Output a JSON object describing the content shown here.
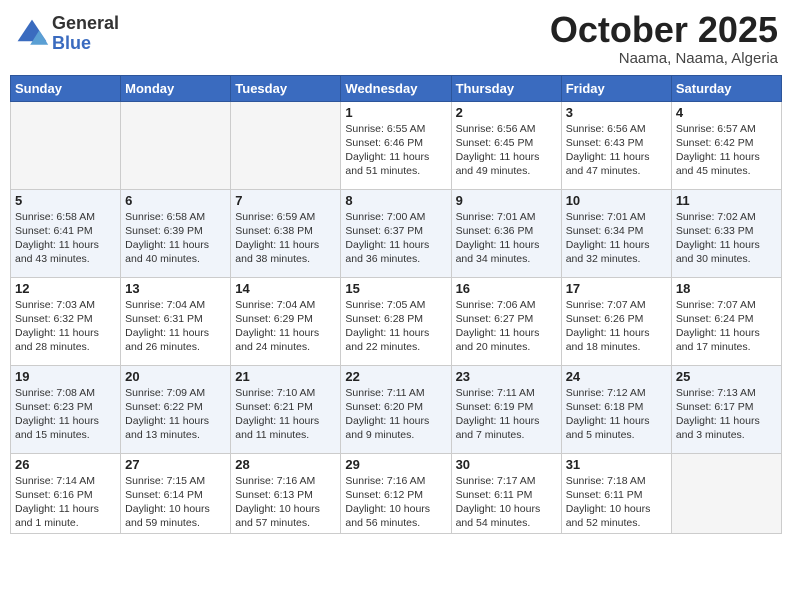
{
  "logo": {
    "general": "General",
    "blue": "Blue"
  },
  "title": "October 2025",
  "location": "Naama, Naama, Algeria",
  "weekdays": [
    "Sunday",
    "Monday",
    "Tuesday",
    "Wednesday",
    "Thursday",
    "Friday",
    "Saturday"
  ],
  "weeks": [
    [
      {
        "day": "",
        "info": ""
      },
      {
        "day": "",
        "info": ""
      },
      {
        "day": "",
        "info": ""
      },
      {
        "day": "1",
        "info": "Sunrise: 6:55 AM\nSunset: 6:46 PM\nDaylight: 11 hours\nand 51 minutes."
      },
      {
        "day": "2",
        "info": "Sunrise: 6:56 AM\nSunset: 6:45 PM\nDaylight: 11 hours\nand 49 minutes."
      },
      {
        "day": "3",
        "info": "Sunrise: 6:56 AM\nSunset: 6:43 PM\nDaylight: 11 hours\nand 47 minutes."
      },
      {
        "day": "4",
        "info": "Sunrise: 6:57 AM\nSunset: 6:42 PM\nDaylight: 11 hours\nand 45 minutes."
      }
    ],
    [
      {
        "day": "5",
        "info": "Sunrise: 6:58 AM\nSunset: 6:41 PM\nDaylight: 11 hours\nand 43 minutes."
      },
      {
        "day": "6",
        "info": "Sunrise: 6:58 AM\nSunset: 6:39 PM\nDaylight: 11 hours\nand 40 minutes."
      },
      {
        "day": "7",
        "info": "Sunrise: 6:59 AM\nSunset: 6:38 PM\nDaylight: 11 hours\nand 38 minutes."
      },
      {
        "day": "8",
        "info": "Sunrise: 7:00 AM\nSunset: 6:37 PM\nDaylight: 11 hours\nand 36 minutes."
      },
      {
        "day": "9",
        "info": "Sunrise: 7:01 AM\nSunset: 6:36 PM\nDaylight: 11 hours\nand 34 minutes."
      },
      {
        "day": "10",
        "info": "Sunrise: 7:01 AM\nSunset: 6:34 PM\nDaylight: 11 hours\nand 32 minutes."
      },
      {
        "day": "11",
        "info": "Sunrise: 7:02 AM\nSunset: 6:33 PM\nDaylight: 11 hours\nand 30 minutes."
      }
    ],
    [
      {
        "day": "12",
        "info": "Sunrise: 7:03 AM\nSunset: 6:32 PM\nDaylight: 11 hours\nand 28 minutes."
      },
      {
        "day": "13",
        "info": "Sunrise: 7:04 AM\nSunset: 6:31 PM\nDaylight: 11 hours\nand 26 minutes."
      },
      {
        "day": "14",
        "info": "Sunrise: 7:04 AM\nSunset: 6:29 PM\nDaylight: 11 hours\nand 24 minutes."
      },
      {
        "day": "15",
        "info": "Sunrise: 7:05 AM\nSunset: 6:28 PM\nDaylight: 11 hours\nand 22 minutes."
      },
      {
        "day": "16",
        "info": "Sunrise: 7:06 AM\nSunset: 6:27 PM\nDaylight: 11 hours\nand 20 minutes."
      },
      {
        "day": "17",
        "info": "Sunrise: 7:07 AM\nSunset: 6:26 PM\nDaylight: 11 hours\nand 18 minutes."
      },
      {
        "day": "18",
        "info": "Sunrise: 7:07 AM\nSunset: 6:24 PM\nDaylight: 11 hours\nand 17 minutes."
      }
    ],
    [
      {
        "day": "19",
        "info": "Sunrise: 7:08 AM\nSunset: 6:23 PM\nDaylight: 11 hours\nand 15 minutes."
      },
      {
        "day": "20",
        "info": "Sunrise: 7:09 AM\nSunset: 6:22 PM\nDaylight: 11 hours\nand 13 minutes."
      },
      {
        "day": "21",
        "info": "Sunrise: 7:10 AM\nSunset: 6:21 PM\nDaylight: 11 hours\nand 11 minutes."
      },
      {
        "day": "22",
        "info": "Sunrise: 7:11 AM\nSunset: 6:20 PM\nDaylight: 11 hours\nand 9 minutes."
      },
      {
        "day": "23",
        "info": "Sunrise: 7:11 AM\nSunset: 6:19 PM\nDaylight: 11 hours\nand 7 minutes."
      },
      {
        "day": "24",
        "info": "Sunrise: 7:12 AM\nSunset: 6:18 PM\nDaylight: 11 hours\nand 5 minutes."
      },
      {
        "day": "25",
        "info": "Sunrise: 7:13 AM\nSunset: 6:17 PM\nDaylight: 11 hours\nand 3 minutes."
      }
    ],
    [
      {
        "day": "26",
        "info": "Sunrise: 7:14 AM\nSunset: 6:16 PM\nDaylight: 11 hours\nand 1 minute."
      },
      {
        "day": "27",
        "info": "Sunrise: 7:15 AM\nSunset: 6:14 PM\nDaylight: 10 hours\nand 59 minutes."
      },
      {
        "day": "28",
        "info": "Sunrise: 7:16 AM\nSunset: 6:13 PM\nDaylight: 10 hours\nand 57 minutes."
      },
      {
        "day": "29",
        "info": "Sunrise: 7:16 AM\nSunset: 6:12 PM\nDaylight: 10 hours\nand 56 minutes."
      },
      {
        "day": "30",
        "info": "Sunrise: 7:17 AM\nSunset: 6:11 PM\nDaylight: 10 hours\nand 54 minutes."
      },
      {
        "day": "31",
        "info": "Sunrise: 7:18 AM\nSunset: 6:11 PM\nDaylight: 10 hours\nand 52 minutes."
      },
      {
        "day": "",
        "info": ""
      }
    ]
  ]
}
